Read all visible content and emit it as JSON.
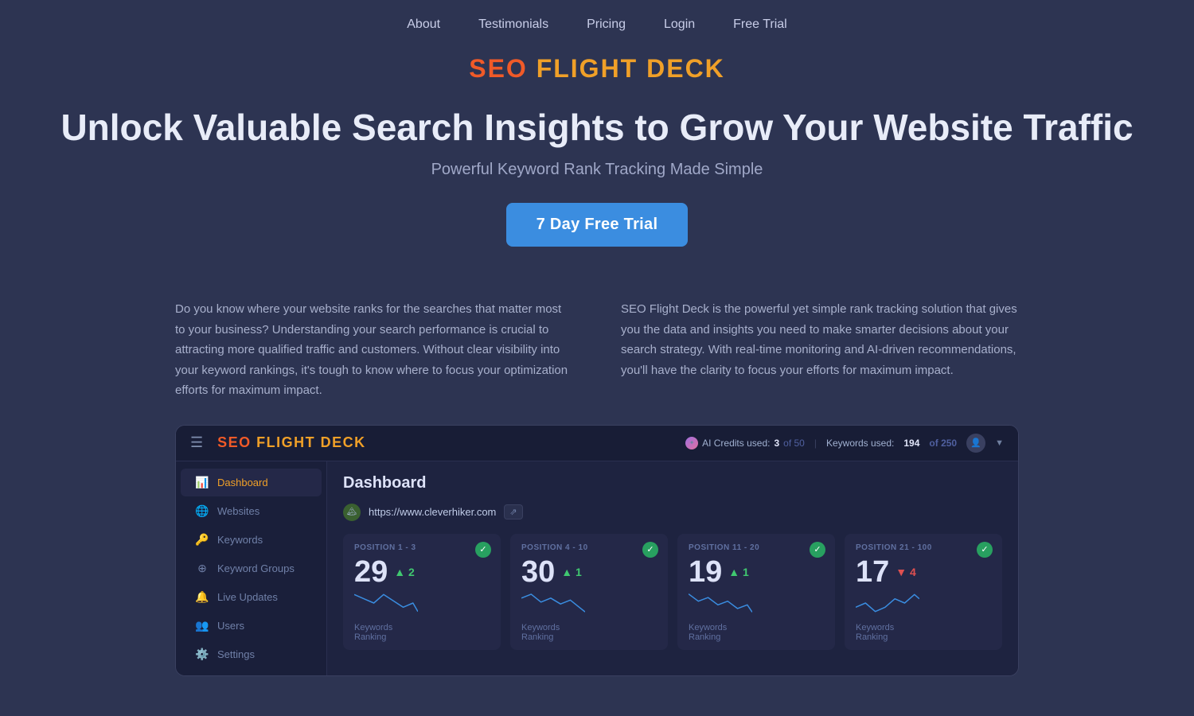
{
  "nav": {
    "items": [
      "About",
      "Testimonials",
      "Pricing",
      "Login",
      "Free Trial"
    ]
  },
  "hero": {
    "logo": {
      "seo": "SEO",
      "flight": "FLIGHT",
      "deck": "DECK"
    },
    "headline": "Unlock Valuable Search Insights to Grow Your Website Traffic",
    "subheadline": "Powerful Keyword Rank Tracking Made Simple",
    "cta": "7 Day Free Trial"
  },
  "columns": {
    "left": "Do you know where your website ranks for the searches that matter most to your business? Understanding your search performance is crucial to attracting more qualified traffic and customers. Without clear visibility into your keyword rankings, it's tough to know where to focus your optimization efforts for maximum impact.",
    "right": "SEO Flight Deck is the powerful yet simple rank tracking solution that gives you the data and insights you need to make smarter decisions about your search strategy. With real-time monitoring and AI-driven recommendations, you'll have the clarity to focus your efforts for maximum impact."
  },
  "mockup": {
    "topbar": {
      "logo_seo": "SEO",
      "logo_rest": "FLIGHT DECK",
      "ai_credits_label": "AI Credits used:",
      "ai_credits_used": "3",
      "ai_credits_of": "of",
      "ai_credits_total": "50",
      "kw_label": "Keywords used:",
      "kw_used": "194",
      "kw_of": "of",
      "kw_total": "250"
    },
    "sidebar": [
      {
        "icon": "📊",
        "label": "Dashboard",
        "active": true
      },
      {
        "icon": "🌐",
        "label": "Websites",
        "active": false
      },
      {
        "icon": "🔑",
        "label": "Keywords",
        "active": false
      },
      {
        "icon": "⚙️",
        "label": "Keyword Groups",
        "active": false
      },
      {
        "icon": "🔔",
        "label": "Live Updates",
        "active": false
      },
      {
        "icon": "👥",
        "label": "Users",
        "active": false
      },
      {
        "icon": "⚙️",
        "label": "Settings",
        "active": false
      }
    ],
    "dashboard": {
      "title": "Dashboard",
      "website": "https://www.cleverhiker.com",
      "cards": [
        {
          "position": "POSITION 1 - 3",
          "number": "29",
          "delta": "2",
          "delta_dir": "up",
          "sub1": "Keywords",
          "sub2": "Ranking",
          "check_color": "green"
        },
        {
          "position": "POSITION 4 - 10",
          "number": "30",
          "delta": "1",
          "delta_dir": "up",
          "sub1": "Keywords",
          "sub2": "Ranking",
          "check_color": "green"
        },
        {
          "position": "POSITION 11 - 20",
          "number": "19",
          "delta": "1",
          "delta_dir": "up",
          "sub1": "Keywords",
          "sub2": "Ranking",
          "check_color": "green"
        },
        {
          "position": "POSITION 21 - 100",
          "number": "17",
          "delta": "4",
          "delta_dir": "down",
          "sub1": "Keywords",
          "sub2": "Ranking",
          "check_color": "green"
        }
      ]
    }
  }
}
